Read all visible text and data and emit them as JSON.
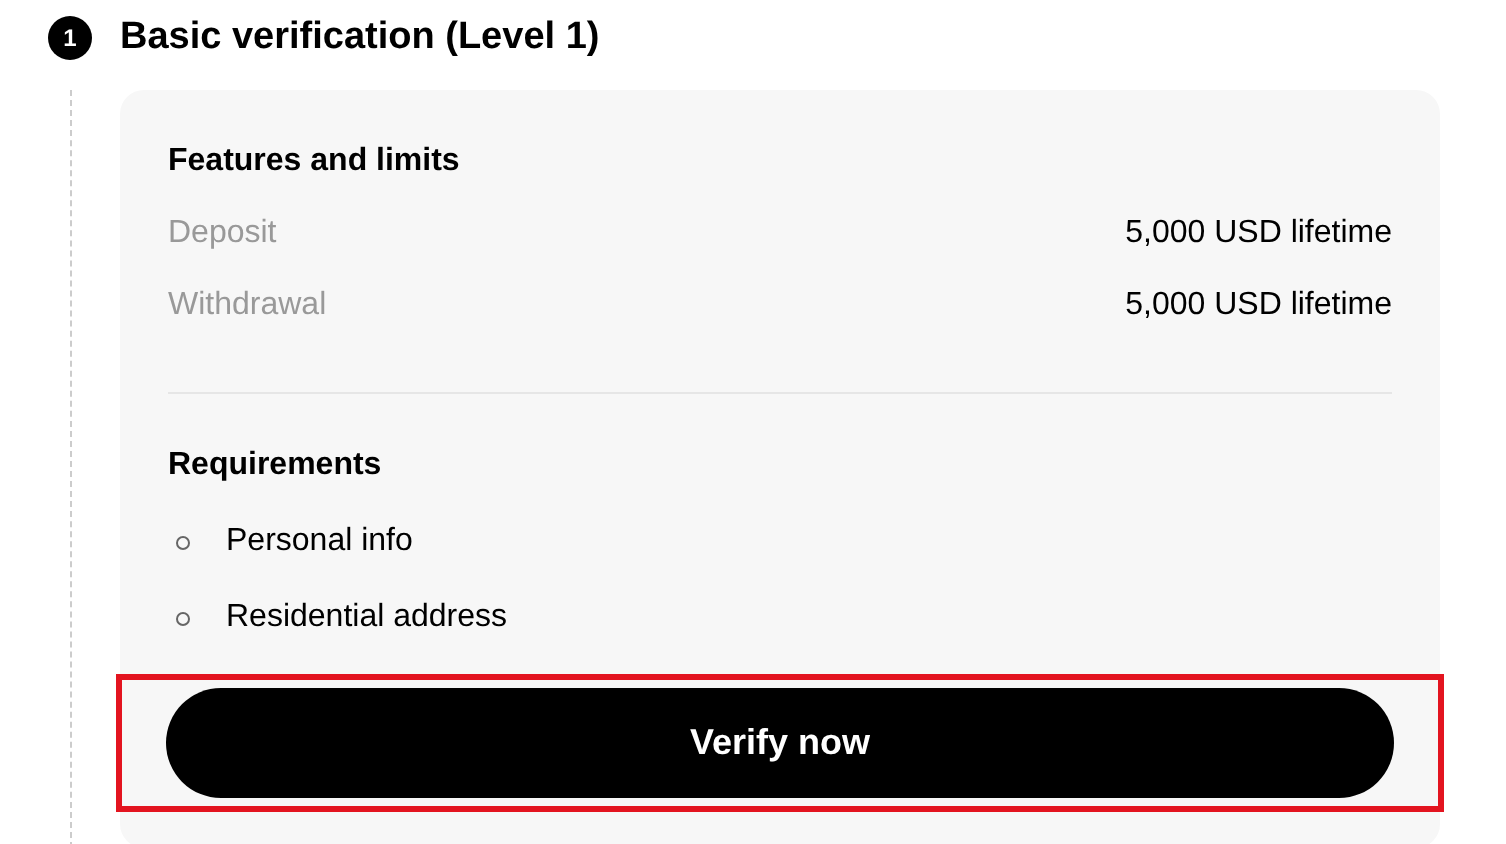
{
  "step": {
    "number": "1",
    "title": "Basic verification (Level 1)"
  },
  "features": {
    "heading": "Features and limits",
    "rows": [
      {
        "label": "Deposit",
        "value": "5,000 USD lifetime"
      },
      {
        "label": "Withdrawal",
        "value": "5,000 USD lifetime"
      }
    ]
  },
  "requirements": {
    "heading": "Requirements",
    "items": [
      "Personal info",
      "Residential address"
    ]
  },
  "button": {
    "label": "Verify now",
    "highlighted": true
  }
}
